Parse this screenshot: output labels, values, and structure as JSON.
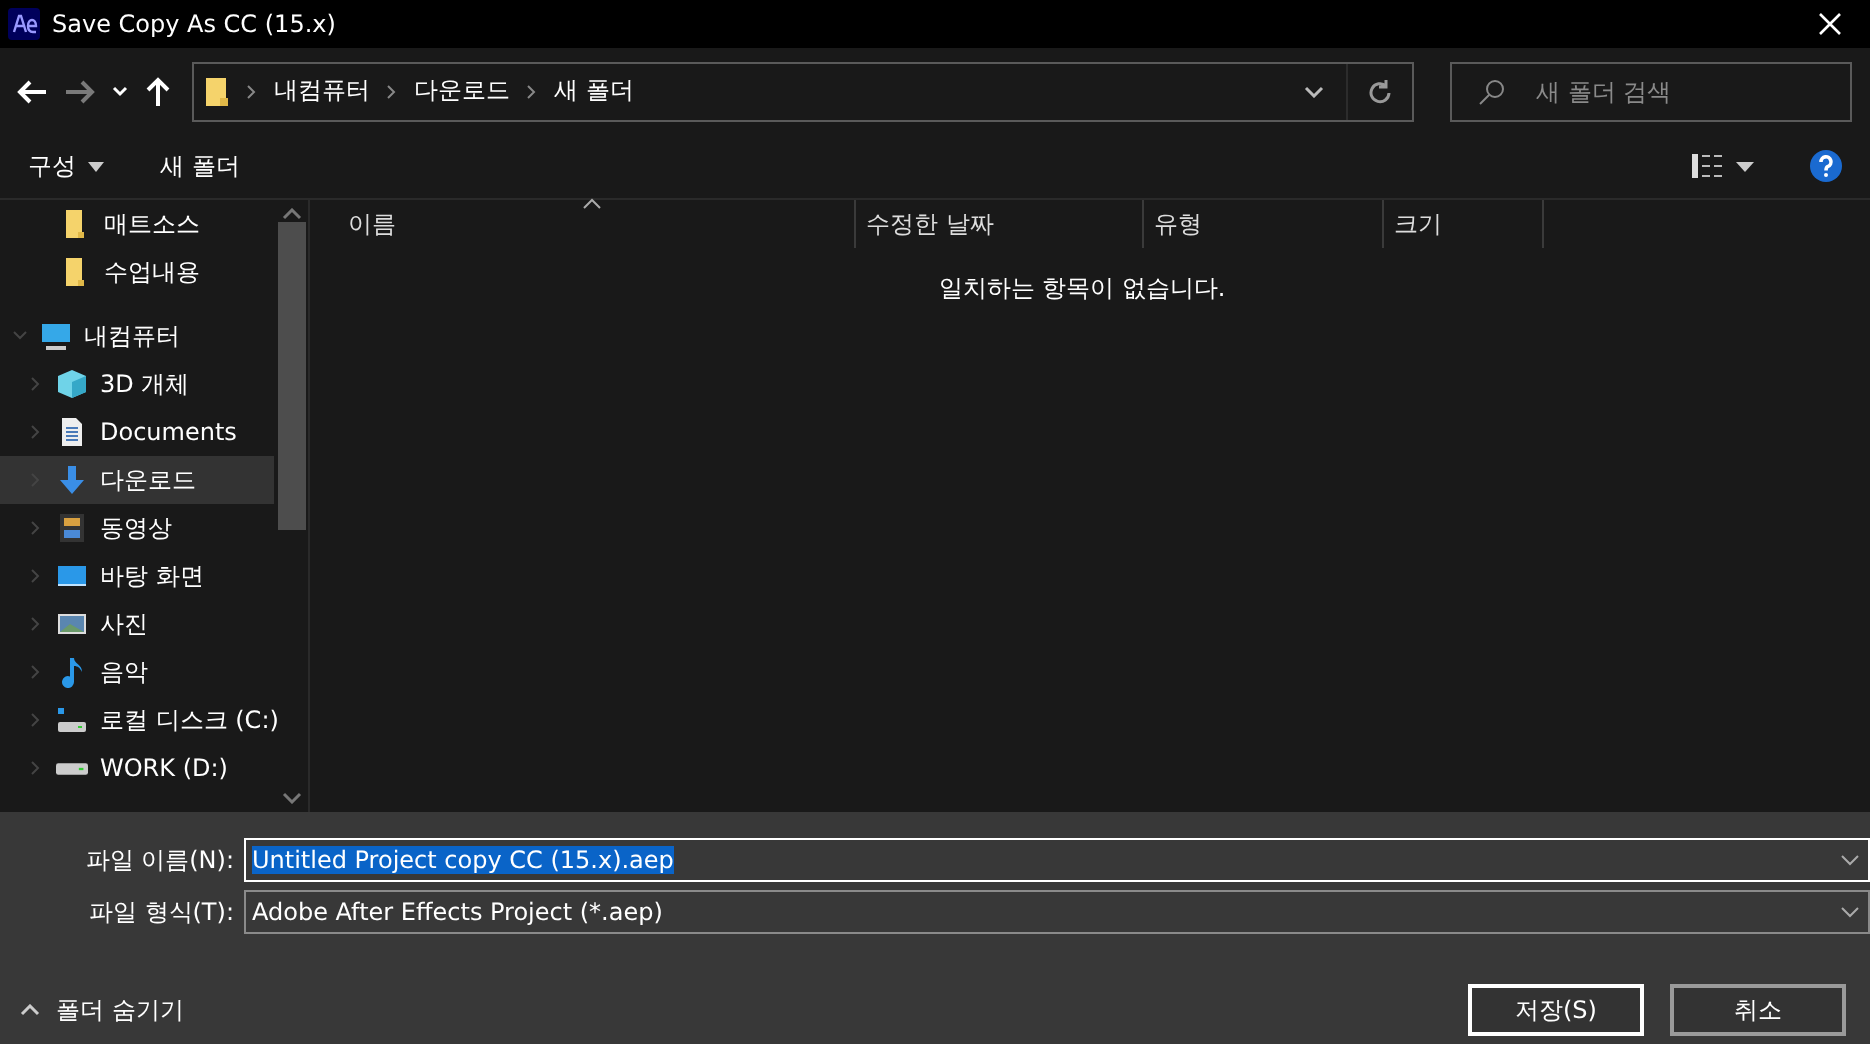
{
  "window": {
    "title": "Save Copy As CC (15.x)"
  },
  "address_bar": {
    "path": [
      {
        "label": "내컴퓨터"
      },
      {
        "label": "다운로드"
      },
      {
        "label": "새 폴더"
      }
    ]
  },
  "search": {
    "placeholder": "새 폴더 검색"
  },
  "toolbar": {
    "organize": "구성",
    "new_folder": "새 폴더"
  },
  "sidebar": {
    "items": [
      {
        "label": "매트소스",
        "kind": "folder",
        "selected": false
      },
      {
        "label": "수업내용",
        "kind": "folder",
        "selected": false
      },
      {
        "label": "내컴퓨터",
        "kind": "pc",
        "selected": false,
        "expanded": true,
        "children": [
          {
            "label": "3D 개체",
            "kind": "cube",
            "selected": false,
            "expanded": false
          },
          {
            "label": "Documents",
            "kind": "document",
            "selected": false,
            "expanded": false
          },
          {
            "label": "다운로드",
            "kind": "download",
            "selected": true,
            "expanded": false
          },
          {
            "label": "동영상",
            "kind": "video",
            "selected": false,
            "expanded": false
          },
          {
            "label": "바탕 화면",
            "kind": "desktop",
            "selected": false,
            "expanded": false
          },
          {
            "label": "사진",
            "kind": "picture",
            "selected": false,
            "expanded": false
          },
          {
            "label": "음악",
            "kind": "music",
            "selected": false,
            "expanded": false
          },
          {
            "label": "로컬 디스크 (C:)",
            "kind": "system-disk",
            "selected": false,
            "expanded": false
          },
          {
            "label": "WORK (D:)",
            "kind": "disk",
            "selected": false,
            "expanded": false
          }
        ]
      }
    ]
  },
  "table": {
    "columns": [
      {
        "label": "이름",
        "sorted": true
      },
      {
        "label": "수정한 날짜",
        "sorted": false
      },
      {
        "label": "유형",
        "sorted": false
      },
      {
        "label": "크기",
        "sorted": false
      }
    ],
    "empty_message": "일치하는 항목이 없습니다."
  },
  "form": {
    "file_name": {
      "label": "파일 이름(N):",
      "value": "Untitled Project copy CC (15.x).aep"
    },
    "file_type": {
      "label": "파일 형식(T):",
      "value": "Adobe After Effects Project (*.aep)"
    }
  },
  "hide_folders": "폴더 숨기기",
  "buttons": [
    {
      "label": "저장(S)",
      "kind": "primary"
    },
    {
      "label": "취소",
      "kind": "secondary"
    }
  ]
}
